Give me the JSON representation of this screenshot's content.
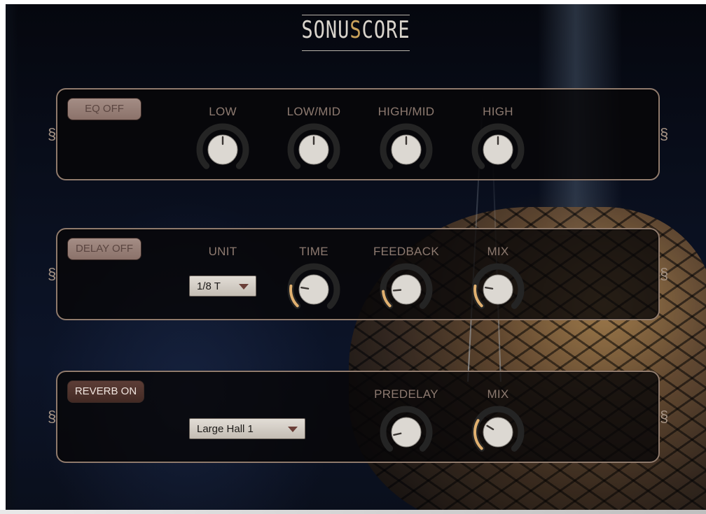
{
  "brand": {
    "logo_prefix": "SONU",
    "logo_s": "S",
    "logo_suffix": "CORE"
  },
  "colors": {
    "accent": "#e0b070",
    "panel_border": "#8f7a6c",
    "label": "#8d7a70",
    "toggle_on_bg": "#4e332d",
    "toggle_off_bg": "#9a827a"
  },
  "eq": {
    "toggle_label": "EQ OFF",
    "toggle_state": "off",
    "knobs": [
      {
        "label": "LOW",
        "value": 0.5,
        "ring_fill": 0
      },
      {
        "label": "LOW/MID",
        "value": 0.5,
        "ring_fill": 0
      },
      {
        "label": "HIGH/MID",
        "value": 0.5,
        "ring_fill": 0
      },
      {
        "label": "HIGH",
        "value": 0.5,
        "ring_fill": 0
      }
    ]
  },
  "delay": {
    "toggle_label": "DELAY OFF",
    "toggle_state": "off",
    "unit_label": "UNIT",
    "unit_value": "1/8 T",
    "knobs": [
      {
        "label": "TIME",
        "value": 0.2,
        "ring_fill": 0.2
      },
      {
        "label": "FEEDBACK",
        "value": 0.15,
        "ring_fill": 0.15
      },
      {
        "label": "MIX",
        "value": 0.2,
        "ring_fill": 0.2
      }
    ]
  },
  "reverb": {
    "toggle_label": "REVERB ON",
    "toggle_state": "on",
    "preset_value": "Large Hall 1",
    "knobs": [
      {
        "label": "PREDELAY",
        "value": 0.12,
        "ring_fill": 0
      },
      {
        "label": "MIX",
        "value": 0.28,
        "ring_fill": 0.28
      }
    ]
  }
}
